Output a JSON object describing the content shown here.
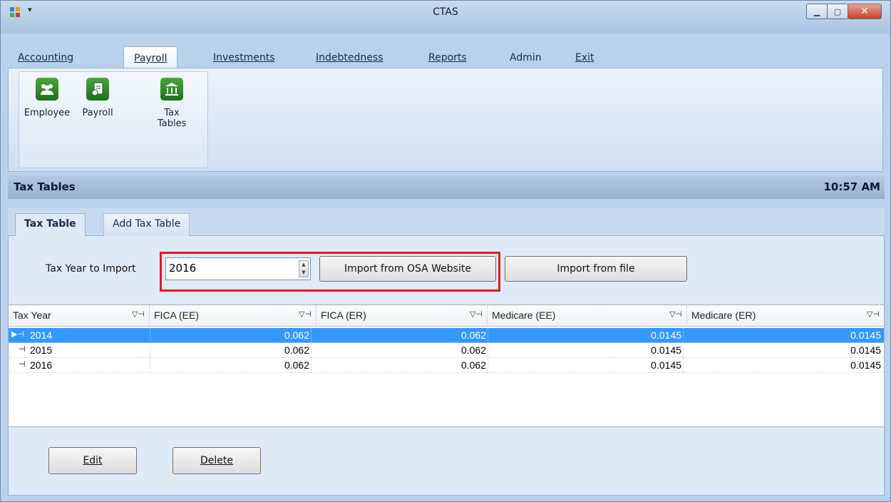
{
  "window": {
    "title": "CTAS"
  },
  "menu": {
    "tabs": [
      {
        "label": "Accounting"
      },
      {
        "label": "Payroll"
      },
      {
        "label": "Investments"
      },
      {
        "label": "Indebtedness"
      },
      {
        "label": "Reports"
      },
      {
        "label": "Admin"
      },
      {
        "label": "Exit"
      }
    ]
  },
  "ribbon": {
    "buttons": [
      {
        "label": "Employee",
        "icon": "people-icon"
      },
      {
        "label": "Payroll",
        "icon": "document-icon"
      },
      {
        "label": "Tax Tables",
        "icon": "bank-icon"
      }
    ]
  },
  "section": {
    "title": "Tax Tables",
    "time": "10:57 AM"
  },
  "tabs": [
    {
      "label": "Tax Table"
    },
    {
      "label": "Add Tax Table"
    }
  ],
  "import": {
    "label": "Tax Year to Import",
    "year_value": "2016",
    "osa_button": "Import from OSA Website",
    "file_button": "Import from file"
  },
  "grid": {
    "columns": [
      "Tax Year",
      "FICA (EE)",
      "FICA (ER)",
      "Medicare (EE)",
      "Medicare (ER)"
    ],
    "rows": [
      {
        "year": "2014",
        "fica_ee": "0.062",
        "fica_er": "0.062",
        "medicare_ee": "0.0145",
        "medicare_er": "0.0145"
      },
      {
        "year": "2015",
        "fica_ee": "0.062",
        "fica_er": "0.062",
        "medicare_ee": "0.0145",
        "medicare_er": "0.0145"
      },
      {
        "year": "2016",
        "fica_ee": "0.062",
        "fica_er": "0.062",
        "medicare_ee": "0.0145",
        "medicare_er": "0.0145"
      }
    ]
  },
  "actions": {
    "edit": "Edit",
    "delete": "Delete"
  },
  "colors": {
    "selection": "#3399ff",
    "highlight_border": "#e41b1b"
  }
}
